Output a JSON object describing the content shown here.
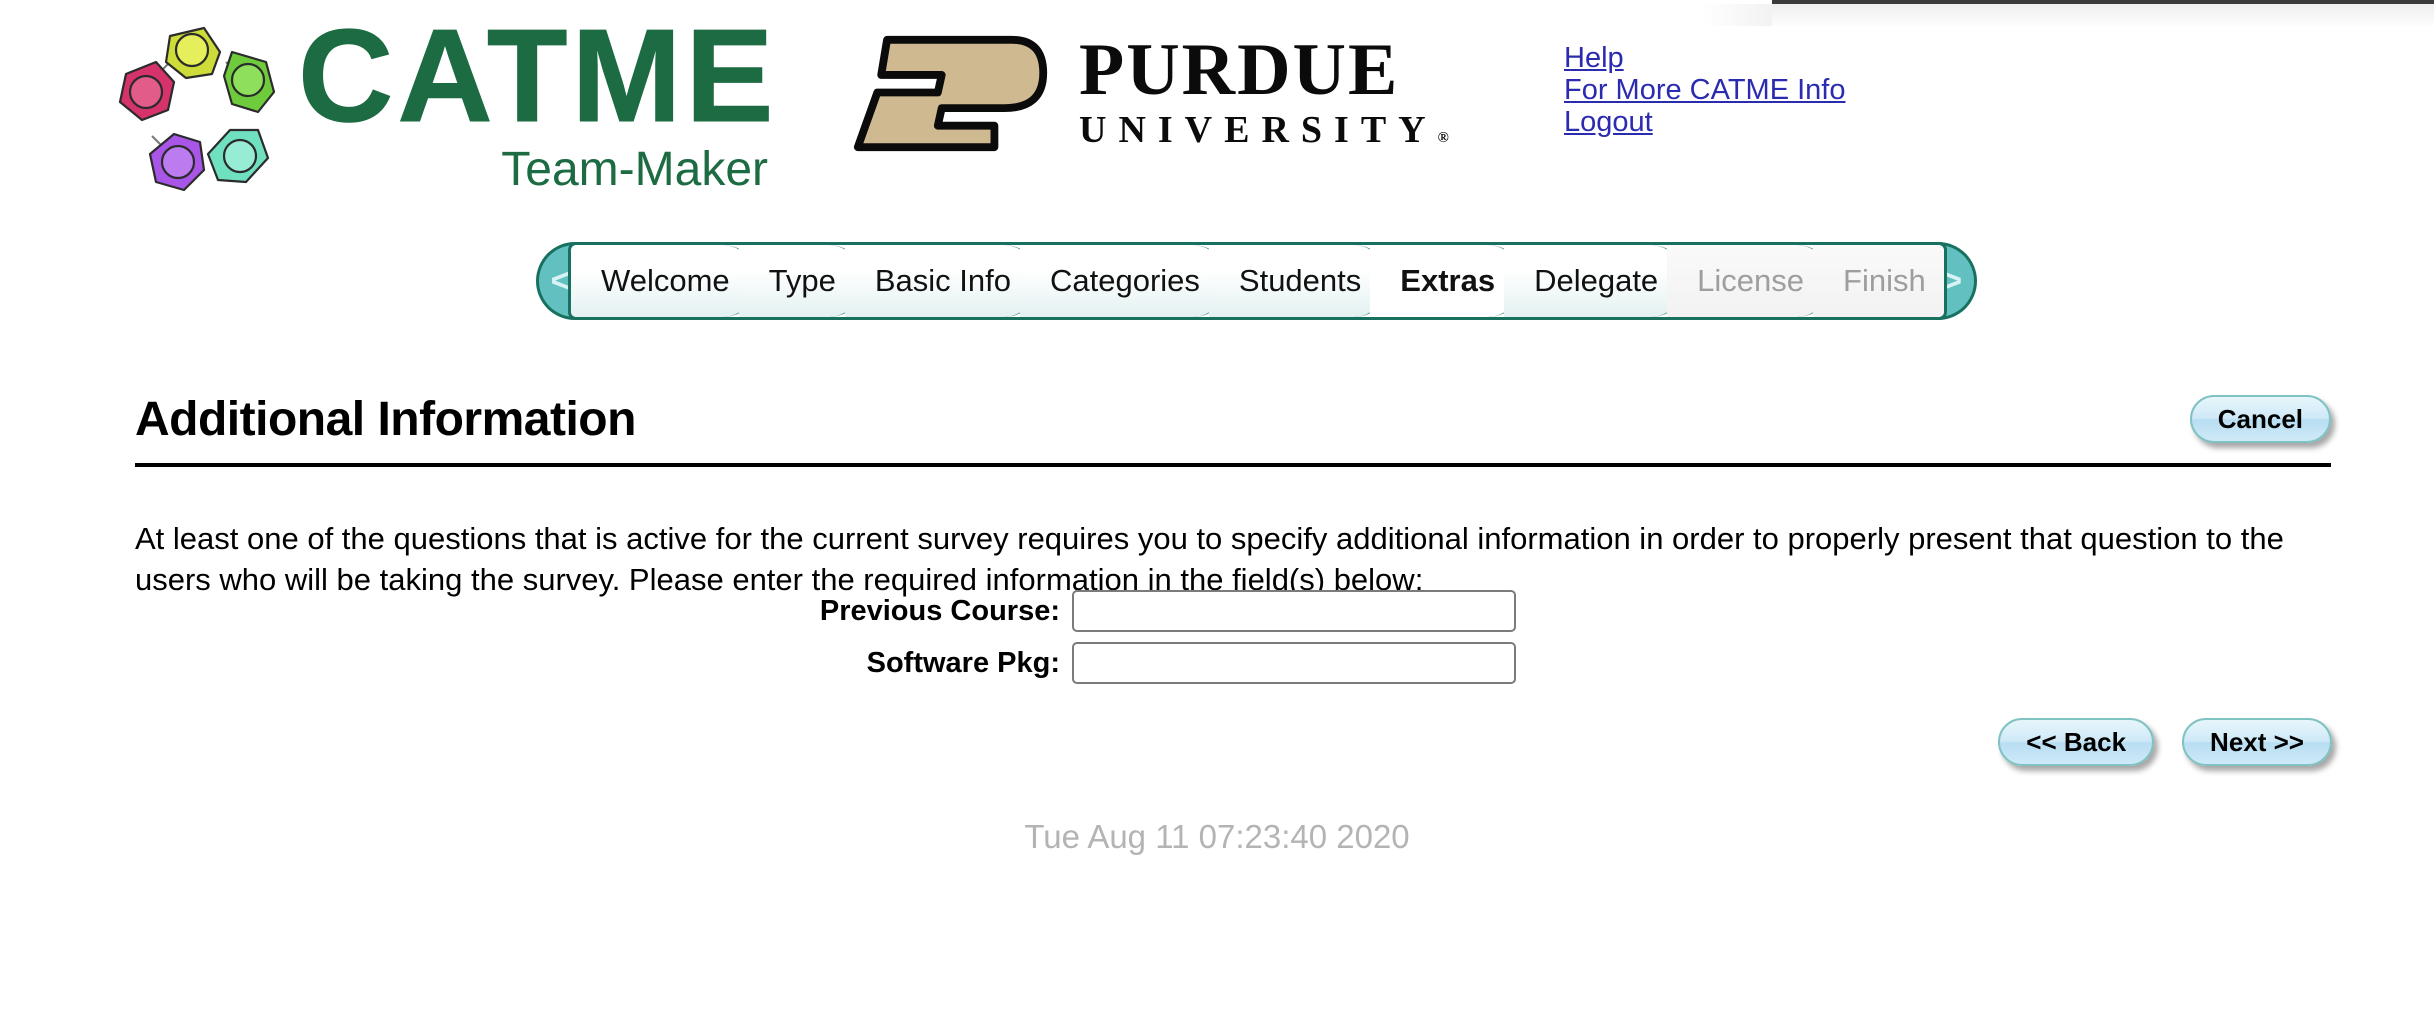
{
  "brand": {
    "catme_name": "CATME",
    "catme_tagline": "Team-Maker",
    "catme_logo_icon": "catme-people-circle-icon",
    "purdue_p_icon": "purdue-p-logo-icon",
    "purdue_name": "PURDUE",
    "purdue_university": "UNIVERSITY",
    "purdue_registered_mark": "®",
    "green": "#1c6b42",
    "purdue_gold": "#cfb991"
  },
  "header_links": [
    {
      "label": "Help",
      "name": "help-link"
    },
    {
      "label": "For More CATME Info",
      "name": "more-catme-info-link"
    },
    {
      "label": "Logout",
      "name": "logout-link"
    }
  ],
  "wizard": {
    "prev_arrow": "<",
    "next_arrow": ">",
    "steps": [
      {
        "label": "Welcome",
        "state": "done"
      },
      {
        "label": "Type",
        "state": "done"
      },
      {
        "label": "Basic Info",
        "state": "done"
      },
      {
        "label": "Categories",
        "state": "done"
      },
      {
        "label": "Students",
        "state": "done"
      },
      {
        "label": "Extras",
        "state": "current"
      },
      {
        "label": "Delegate",
        "state": "available"
      },
      {
        "label": "License",
        "state": "disabled"
      },
      {
        "label": "Finish",
        "state": "disabled"
      }
    ]
  },
  "page": {
    "title": "Additional Information",
    "cancel_label": "Cancel",
    "intro": "At least one of the questions that is active for the current survey requires you to specify additional information in order to properly present that question to the users who will be taking the survey. Please enter the required information in the field(s) below:"
  },
  "form": {
    "fields": [
      {
        "label": "Previous Course:",
        "value": "",
        "placeholder": "",
        "name": "previous-course"
      },
      {
        "label": "Software Pkg:",
        "value": "",
        "placeholder": "",
        "name": "software-pkg"
      }
    ]
  },
  "footer": {
    "back_label": "<< Back",
    "next_label": "Next >>",
    "timestamp": "Tue Aug 11 07:23:40 2020"
  }
}
